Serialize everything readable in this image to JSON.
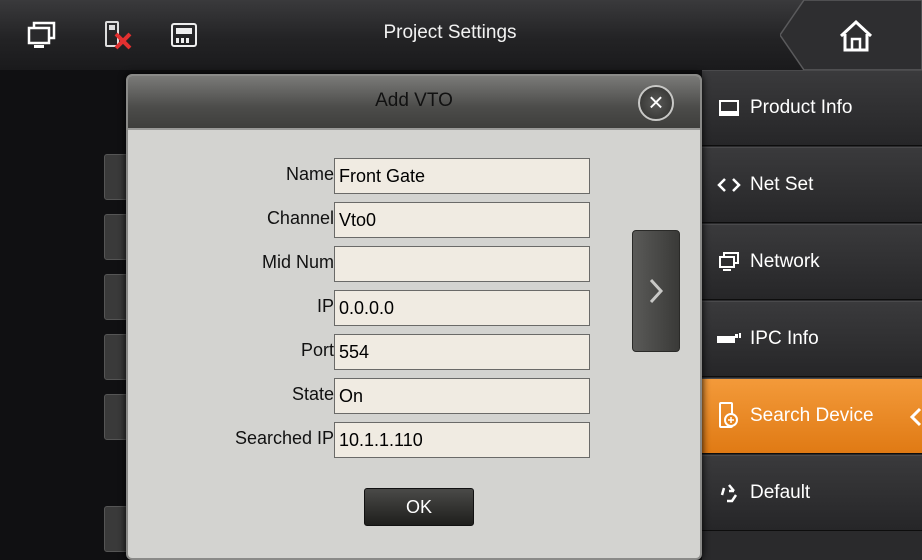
{
  "header": {
    "title": "Project Settings",
    "icons": [
      "monitor-icon",
      "disconnected-device-icon",
      "sd-card-icon"
    ],
    "home_icon": "home-icon"
  },
  "dialog": {
    "title": "Add VTO",
    "close_icon": "close-icon",
    "fields": [
      {
        "label": "Name",
        "value": "Front Gate"
      },
      {
        "label": "Channel",
        "value": "Vto0"
      },
      {
        "label": "Mid Num",
        "value": ""
      },
      {
        "label": "IP",
        "value": "0.0.0.0"
      },
      {
        "label": "Port",
        "value": "554"
      },
      {
        "label": "State",
        "value": "On"
      },
      {
        "label": "Searched IP",
        "value": "10.1.1.110"
      }
    ],
    "next_icon": "chevron-right-icon",
    "ok_label": "OK"
  },
  "menu": {
    "items": [
      {
        "label": "Product Info",
        "icon": "product-info-icon"
      },
      {
        "label": "Net Set",
        "icon": "code-brackets-icon"
      },
      {
        "label": "Network",
        "icon": "network-icon"
      },
      {
        "label": "IPC Info",
        "icon": "camera-icon"
      },
      {
        "label": "Search Device",
        "icon": "search-device-icon",
        "active": true
      },
      {
        "label": "Default",
        "icon": "recycle-icon"
      }
    ]
  },
  "colors": {
    "accent": "#e8861e",
    "background": "#1c1c1e",
    "dialog": "#d3d3d0",
    "field": "#f0ebe2"
  }
}
